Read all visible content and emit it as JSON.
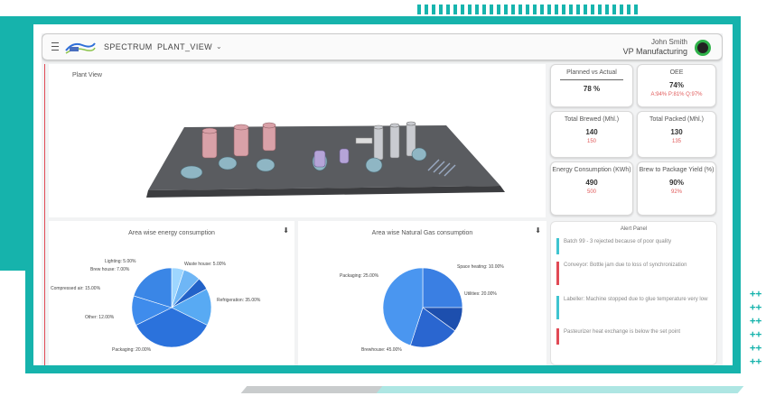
{
  "header": {
    "app_name": "SPECTRUM",
    "view_name": "PLANT_VIEW",
    "user_name": "John Smith",
    "user_role": "VP Manufacturing"
  },
  "plant": {
    "title": "Plant View"
  },
  "kpis": [
    {
      "title": "Planned vs Actual",
      "value": "78 %",
      "sub": ""
    },
    {
      "title": "OEE",
      "value": "74%",
      "sub": "A:94% P:81% Q:97%"
    },
    {
      "title": "Total Brewed (Mhl.)",
      "value": "140",
      "sub": "150"
    },
    {
      "title": "Total Packed (Mhl.)",
      "value": "130",
      "sub": "135"
    },
    {
      "title": "Energy Consumption (KWh)",
      "value": "490",
      "sub": "500"
    },
    {
      "title": "Brew to Package Yield (%)",
      "value": "90%",
      "sub": "92%"
    }
  ],
  "energy_chart": {
    "title": "Area wise energy consumption",
    "labels": [
      "Lighting: 5.00%",
      "Brew house: 7.00%",
      "Waste house: 5.00%",
      "Compressed air: 15.00%",
      "Refrigeration: 35.00%",
      "Other: 12.00%",
      "Packaging: 20.00%"
    ]
  },
  "gas_chart": {
    "title": "Area wise Natural Gas consumption",
    "labels": [
      "Packaging: 25.00%",
      "Space heating: 10.00%",
      "Utilities: 20.00%",
      "Brewhouse: 45.00%"
    ]
  },
  "alerts": {
    "title": "Alert Panel",
    "items": [
      {
        "text": "Batch 99 - 3 rejected because of poor quality",
        "color": "#3fc4d0"
      },
      {
        "text": "Conveyor: Bottle jam due to loss of synchronization",
        "color": "#e14a55"
      },
      {
        "text": "Labeller: Machine stopped due to glue temperature very low",
        "color": "#3fc4d0"
      },
      {
        "text": "Pasteurizer heat exchange is below the set point",
        "color": "#e14a55"
      }
    ]
  },
  "colors": {
    "frame": "#16b3ac",
    "alert_red": "#e14a55",
    "alert_blue": "#3fc4d0",
    "pie_blue": "#2f78e0"
  },
  "chart_data": [
    {
      "type": "pie",
      "title": "Area wise energy consumption",
      "categories": [
        "Lighting",
        "Brew house",
        "Waste house",
        "Compressed air",
        "Refrigeration",
        "Other",
        "Packaging"
      ],
      "values": [
        5,
        7,
        5,
        15,
        35,
        12,
        20
      ]
    },
    {
      "type": "pie",
      "title": "Area wise Natural Gas consumption",
      "categories": [
        "Packaging",
        "Space heating",
        "Utilities",
        "Brewhouse"
      ],
      "values": [
        25,
        10,
        20,
        45
      ]
    }
  ]
}
